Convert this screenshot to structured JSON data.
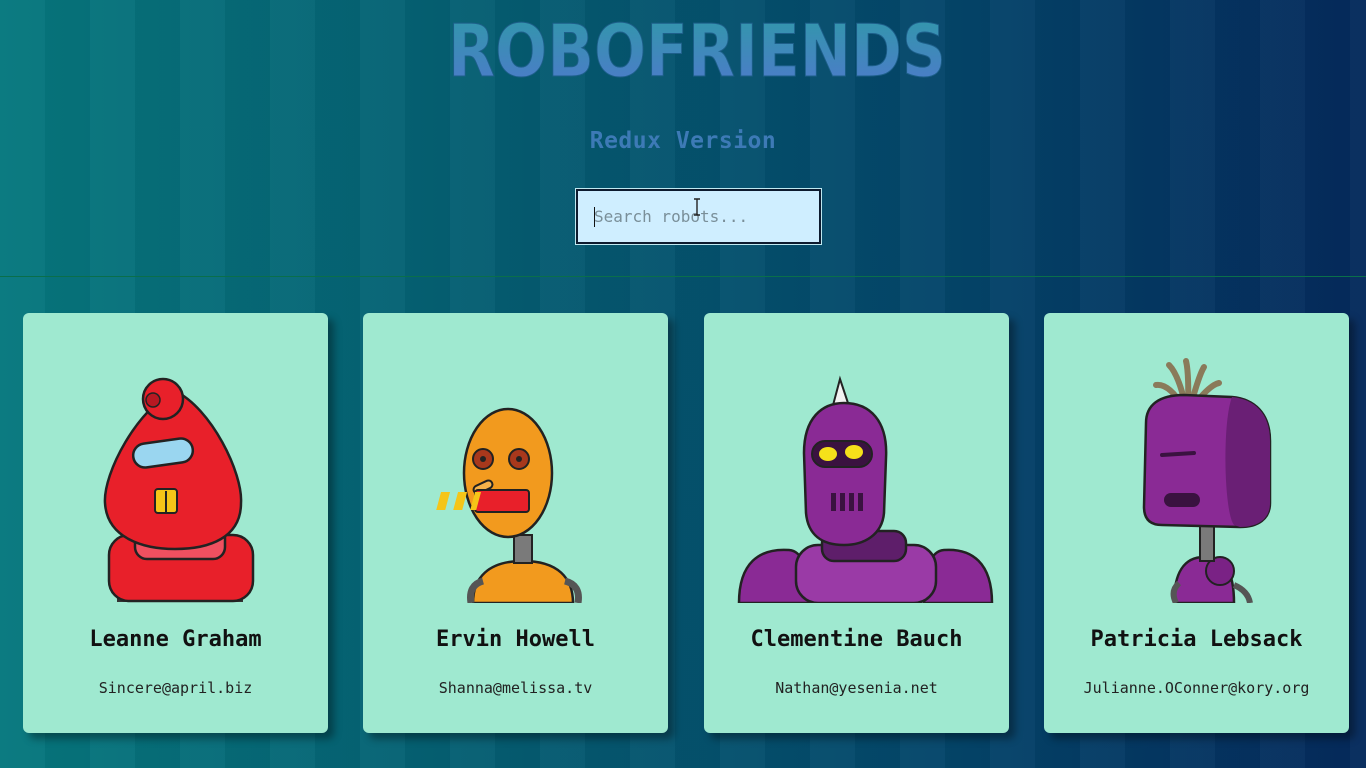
{
  "header": {
    "logo_text": "ROBOFRIENDS",
    "subtitle": "Redux Version"
  },
  "search": {
    "placeholder": "Search robots...",
    "value": ""
  },
  "robots": [
    {
      "name": "Leanne Graham",
      "email": "Sincere@april.biz",
      "color": "#e8202a"
    },
    {
      "name": "Ervin Howell",
      "email": "Shanna@melissa.tv",
      "color": "#f29a1e"
    },
    {
      "name": "Clementine Bauch",
      "email": "Nathan@yesenia.net",
      "color": "#8a2a95"
    },
    {
      "name": "Patricia Lebsack",
      "email": "Julianne.OConner@kory.org",
      "color": "#8a2a95"
    }
  ],
  "colors": {
    "card_bg": "#9fe9d0",
    "logo_top": "#2f9aa8",
    "logo_bottom": "#4f78cc",
    "subtitle": "#3d7ab6"
  }
}
